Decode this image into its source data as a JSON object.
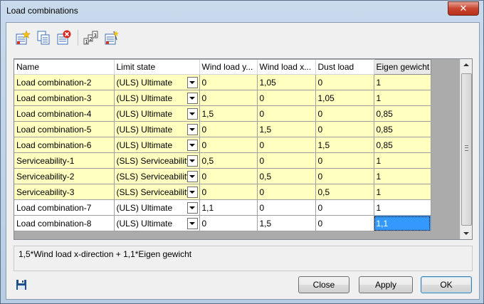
{
  "window": {
    "title": "Load combinations"
  },
  "toolbar": {
    "icons": [
      "new-combination-icon",
      "copy-icon",
      "delete-icon",
      "numbering-icon",
      "generate-icon"
    ]
  },
  "grid": {
    "columns": [
      "Name",
      "Limit state",
      "Wind load y...",
      "Wind load x...",
      "Dust load",
      "Eigen gewicht"
    ],
    "rows": [
      {
        "name": "Load combination-2",
        "state": "(ULS) Ultimate",
        "wy": "0",
        "wx": "1,05",
        "dust": "0",
        "eigen": "1",
        "kind": "uls"
      },
      {
        "name": "Load combination-3",
        "state": "(ULS) Ultimate",
        "wy": "0",
        "wx": "0",
        "dust": "1,05",
        "eigen": "1",
        "kind": "uls"
      },
      {
        "name": "Load combination-4",
        "state": "(ULS) Ultimate",
        "wy": "1,5",
        "wx": "0",
        "dust": "0",
        "eigen": "0,85",
        "kind": "uls"
      },
      {
        "name": "Load combination-5",
        "state": "(ULS) Ultimate",
        "wy": "0",
        "wx": "1,5",
        "dust": "0",
        "eigen": "0,85",
        "kind": "uls"
      },
      {
        "name": "Load combination-6",
        "state": "(ULS) Ultimate",
        "wy": "0",
        "wx": "0",
        "dust": "1,5",
        "eigen": "0,85",
        "kind": "uls"
      },
      {
        "name": "Serviceability-1",
        "state": "(SLS) Serviceability",
        "wy": "0,5",
        "wx": "0",
        "dust": "0",
        "eigen": "1",
        "kind": "sls"
      },
      {
        "name": "Serviceability-2",
        "state": "(SLS) Serviceability",
        "wy": "0",
        "wx": "0,5",
        "dust": "0",
        "eigen": "1",
        "kind": "sls"
      },
      {
        "name": "Serviceability-3",
        "state": "(SLS) Serviceability",
        "wy": "0",
        "wx": "0",
        "dust": "0,5",
        "eigen": "1",
        "kind": "sls"
      },
      {
        "name": "Load combination-7",
        "state": "(ULS) Ultimate",
        "wy": "1,1",
        "wx": "0",
        "dust": "0",
        "eigen": "1",
        "kind": "plain"
      },
      {
        "name": "Load combination-8",
        "state": "(ULS) Ultimate",
        "wy": "0",
        "wx": "1,5",
        "dust": "0",
        "eigen": "1,1",
        "kind": "plain"
      }
    ]
  },
  "description": "1,5*Wind load x-direction + 1,1*Eigen gewicht",
  "buttons": {
    "close": "Close",
    "apply": "Apply",
    "ok": "OK"
  },
  "colors": {
    "highlight_row": "#ffffc0",
    "selection": "#3399ff"
  }
}
